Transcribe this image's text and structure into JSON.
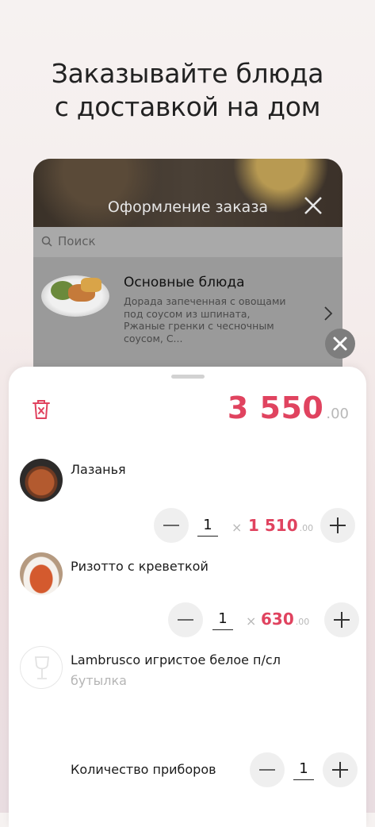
{
  "headline": {
    "line1": "Заказывайте блюда",
    "line2": "с доставкой на дом"
  },
  "background_screen": {
    "title": "Оформление заказа",
    "search_placeholder": "Поиск",
    "category": {
      "title": "Основные блюда",
      "description": "Дорада запеченная с овощами под соусом из шпината, Ржаные гренки с чесночным соусом, С..."
    }
  },
  "cart": {
    "total_int": "3 550",
    "total_frac": ".00",
    "items": [
      {
        "name": "Лазанья",
        "qty": "1",
        "times": "×",
        "price_int": "1 510",
        "price_frac": ".00",
        "icon": "lasagna-photo"
      },
      {
        "name": "Ризотто с креветкой",
        "qty": "1",
        "times": "×",
        "price_int": "630",
        "price_frac": ".00",
        "icon": "risotto-photo"
      },
      {
        "name": "Lambrusco игристое белое п/сл",
        "subtitle": "бутылка",
        "icon": "wine-glass-icon"
      }
    ],
    "cutlery": {
      "label": "Количество приборов",
      "qty": "1"
    }
  },
  "colors": {
    "accent": "#e0435f",
    "muted": "#b8b8b8"
  }
}
